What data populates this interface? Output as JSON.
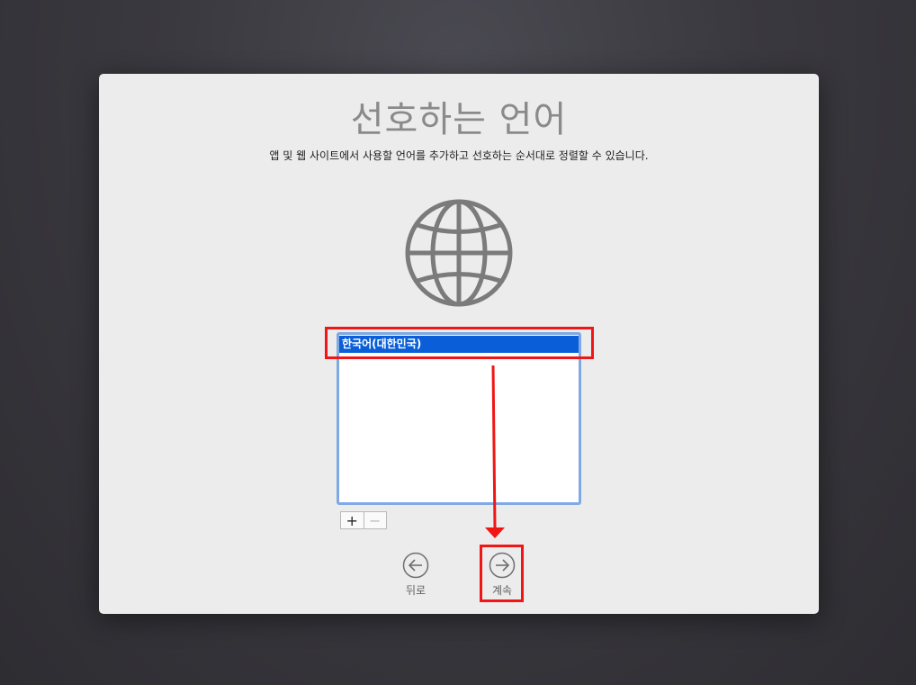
{
  "setup": {
    "title": "선호하는 언어",
    "subtitle": "앱 및 웹 사이트에서 사용할 언어를 추가하고 선호하는 순서대로 정렬할 수 있습니다.",
    "globe_icon": "globe-icon"
  },
  "language_list": {
    "items": [
      {
        "label": "한국어(대한민국)",
        "selected": true
      }
    ],
    "add_label": "+",
    "remove_label": "−",
    "selection_color": "#0a5fd9",
    "border_color": "#7fa8e4"
  },
  "navigation": {
    "back_label": "뒤로",
    "back_icon": "arrow-left-circle-icon",
    "continue_label": "계속",
    "continue_icon": "arrow-right-circle-icon"
  },
  "annotations": {
    "highlight_color": "#f01616"
  }
}
